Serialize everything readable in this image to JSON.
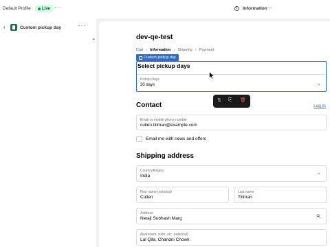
{
  "topbar": {
    "profile_name": "Default Profile",
    "live_badge": "Live",
    "more_icon": "more-horizontal-icon",
    "info_icon": "info-icon",
    "info_label": "Information",
    "info_chevron": "⌵"
  },
  "sidebar": {
    "back_glyph": "‹",
    "block_icon": "app-block-icon",
    "title": "Custom pickup day",
    "more_glyph": "···",
    "scroll_caret": "▲"
  },
  "preview": {
    "store_title": "dev-qe-test",
    "breadcrumb": {
      "cart": "Cart",
      "information": "Information",
      "shipping": "Shipping",
      "payment": "Payment",
      "separator": "›"
    },
    "block_tag": "Custom pickup day",
    "pickup": {
      "heading": "Select pickup days",
      "select_label": "Pickup Days",
      "select_value": "30 days",
      "chevron": "⌄"
    },
    "toolbar": {
      "move_glyph": "⇅",
      "duplicate_glyph": "⎘",
      "delete_glyph": "🗑"
    },
    "contact": {
      "heading": "Contact",
      "login_link": "Log in",
      "email_label": "Email or mobile phone number",
      "email_value": "cullen.tillman@example.com",
      "newsletter_label": "Email me with news and offers"
    },
    "shipping": {
      "heading": "Shipping address",
      "country_label": "Country/Region",
      "country_value": "India",
      "first_name_label": "First name (optional)",
      "first_name_value": "Cullen",
      "last_name_label": "Last name",
      "last_name_value": "Tillman",
      "address_label": "Address",
      "address_value": "Netaji Subhash Marg",
      "apartment_label": "Apartment, suite, etc. (optional)",
      "apartment_value": "Lal Qila, Chandni Chowk",
      "chevron": "⌄",
      "search_glyph": "⚲"
    }
  },
  "colors": {
    "accent_blue": "#2c6ecb",
    "link_blue": "#1773b0",
    "live_green_bg": "#cdfee1",
    "live_green_text": "#0c5132",
    "toolbar_dark": "#1a1a1a",
    "delete_red": "#e25e4c"
  }
}
